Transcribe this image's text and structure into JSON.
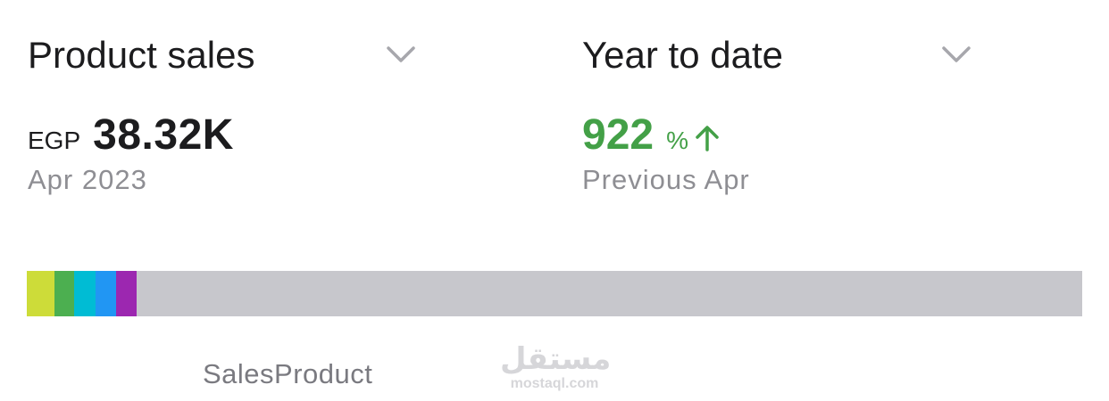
{
  "metric": {
    "label": "Product sales",
    "icon": "chevron-down-icon"
  },
  "period": {
    "label": "Year to date",
    "icon": "chevron-down-icon"
  },
  "sales": {
    "currency": "EGP",
    "amount": "38.32K",
    "period_label": "Apr 2023"
  },
  "change": {
    "value": "922",
    "unit": "%",
    "direction_icon": "arrow-up-icon",
    "comparison_label": "Previous Apr"
  },
  "breakdown_bar": {
    "track_color": "#c7c7cc",
    "segments": [
      {
        "color": "#cddc39",
        "share": 0.026
      },
      {
        "color": "#4caf50",
        "share": 0.019
      },
      {
        "color": "#00bcd4",
        "share": 0.02
      },
      {
        "color": "#2196f3",
        "share": 0.02
      },
      {
        "color": "#9c27b0",
        "share": 0.019
      }
    ]
  },
  "legend": {
    "text": "SalesProduct"
  },
  "watermark": {
    "logo_text": "مستقل",
    "url": "mostaql.com"
  },
  "colors": {
    "positive": "#43a047",
    "text_primary": "#1c1c1e",
    "text_secondary": "#8e8e93",
    "chevron": "#a7a7ac"
  }
}
